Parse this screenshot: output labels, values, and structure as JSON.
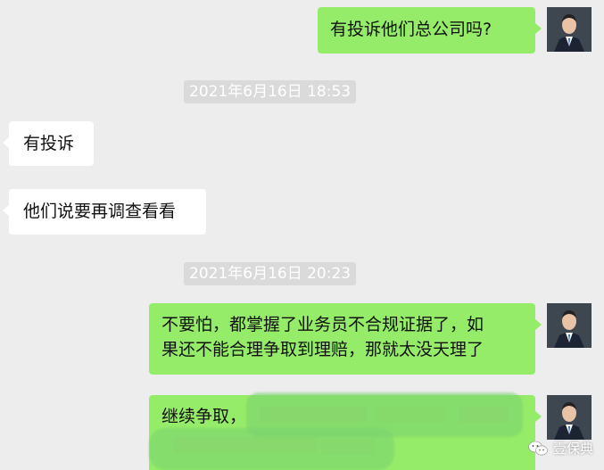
{
  "messages": {
    "m1": {
      "text": "有投诉他们总公司吗?"
    },
    "ts1": "2021年6月16日 18:53",
    "m2": {
      "text": "有投诉"
    },
    "m3": {
      "text": "他们说要再调查看看"
    },
    "ts2": "2021年6月16日 20:23",
    "m4": {
      "line1": "不要怕，都掌握了业务员不合规证据了，如",
      "line2": "果还不能合理争取到理赔，那就太没天理了"
    },
    "m5": {
      "text": "继续争取，"
    }
  },
  "watermark": {
    "text": "壹保典",
    "icon": "wechat-icon"
  },
  "colors": {
    "background": "#ededed",
    "outgoing_bubble": "#95ec69",
    "incoming_bubble": "#ffffff",
    "timestamp_bg": "#dadada"
  }
}
